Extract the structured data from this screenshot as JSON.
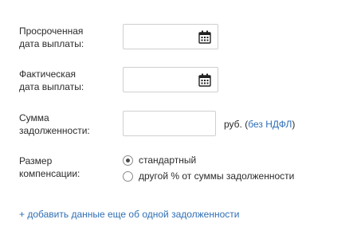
{
  "overdue_date": {
    "label_line1": "Просроченная",
    "label_line2": "дата выплаты:",
    "value": "",
    "icon": "calendar-icon"
  },
  "actual_date": {
    "label_line1": "Фактическая",
    "label_line2": "дата выплаты:",
    "value": "",
    "icon": "calendar-icon"
  },
  "debt_sum": {
    "label_line1": "Сумма",
    "label_line2": "задолженности:",
    "value": "",
    "unit": "руб. (",
    "link_text": "без НДФЛ",
    "unit_close": ")"
  },
  "compensation": {
    "label_line1": "Размер",
    "label_line2": "компенсации:",
    "options": [
      {
        "label": "стандартный",
        "checked": true
      },
      {
        "label": "другой % от суммы задолженности",
        "checked": false
      }
    ]
  },
  "add_link": "+ добавить данные еще об одной задолженности",
  "colors": {
    "link": "#2f6fb5",
    "border": "#cfcfcf"
  }
}
